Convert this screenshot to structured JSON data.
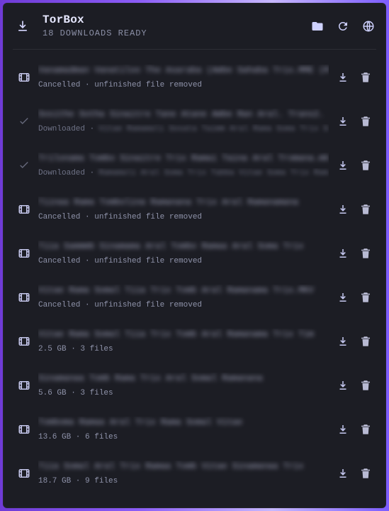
{
  "header": {
    "title": "TorBox",
    "subtitle": "18 DOWNLOADS READY",
    "actions": [
      {
        "name": "folder-button",
        "icon": "folder-icon"
      },
      {
        "name": "refresh-button",
        "icon": "refresh-icon"
      },
      {
        "name": "web-button",
        "icon": "globe-icon"
      }
    ]
  },
  "downloads": [
    {
      "leading_icon": "film-icon",
      "title": "Vanamadman Vanatiloo The Asaraba (Ambe Sahaba Trix.MME (Ramma",
      "status": "Cancelled · unfinished file removed",
      "status_blurred": ""
    },
    {
      "leading_icon": "check-icon",
      "title": "Sosithe Sotha Sinaitre Tane Atane Ambe Ran Aral. Trans2.",
      "status": "Downloaded ·",
      "status_blurred": "Vitae Ramamali Sosata Taimm Aral Rama Soma Trix Somal Ana"
    },
    {
      "leading_icon": "check-icon",
      "title": "Trilonama Tombo Sinaitre Trix Ramai Taina Aral Tromana.mk",
      "status": "Downloaded ·",
      "status_blurred": "Ramamali Aral Soma Trix Tabba Vitae Soma Trix Ramama Somal"
    },
    {
      "leading_icon": "film-icon",
      "title": "Tiinaa Rama Tombolina Ramanana Trix Aral Ramanamana",
      "status": "Cancelled · unfinished file removed",
      "status_blurred": ""
    },
    {
      "leading_icon": "film-icon",
      "title": "Tiia Sammmb Sinamama Aral Tombo Ramaa Aral Soma Trix",
      "status": "Cancelled · unfinished file removed",
      "status_blurred": ""
    },
    {
      "leading_icon": "film-icon",
      "title": "Vitae Rama Somal Tiia Trix Tomb Aral Ramanama Trix.MKV",
      "status": "Cancelled · unfinished file removed",
      "status_blurred": ""
    },
    {
      "leading_icon": "film-icon",
      "title": "Vitae Rama Somal Tiia Trix Tomb Aral Ramanama Trix Tim",
      "status": "2.5 GB · 3 files",
      "status_blurred": ""
    },
    {
      "leading_icon": "film-icon",
      "title": "Sinamanaa Tomb    Rama   Trix Aral Somal Ramanana",
      "status": "5.6 GB · 3 files",
      "status_blurred": ""
    },
    {
      "leading_icon": "film-icon",
      "title": "Tomboma Ramaa   Aral Trix Rama Somal Vitae",
      "status": "13.6 GB · 6 files",
      "status_blurred": ""
    },
    {
      "leading_icon": "film-icon",
      "title": "Tiia Somal Aral Trix Ramaa Tomb Vitae Sinamanaa Trix",
      "status": "18.7 GB · 9 files",
      "status_blurred": ""
    }
  ],
  "row_actions": {
    "download_icon": "download-icon",
    "delete_icon": "trash-icon"
  },
  "colors": {
    "panel_bg": "#1c1d24",
    "frame_gradient_start": "#6f3bd6",
    "frame_gradient_end": "#7c5cff",
    "text_primary": "#e7e8ff",
    "text_secondary": "#8f93aa",
    "icon": "#d2d5ff"
  }
}
